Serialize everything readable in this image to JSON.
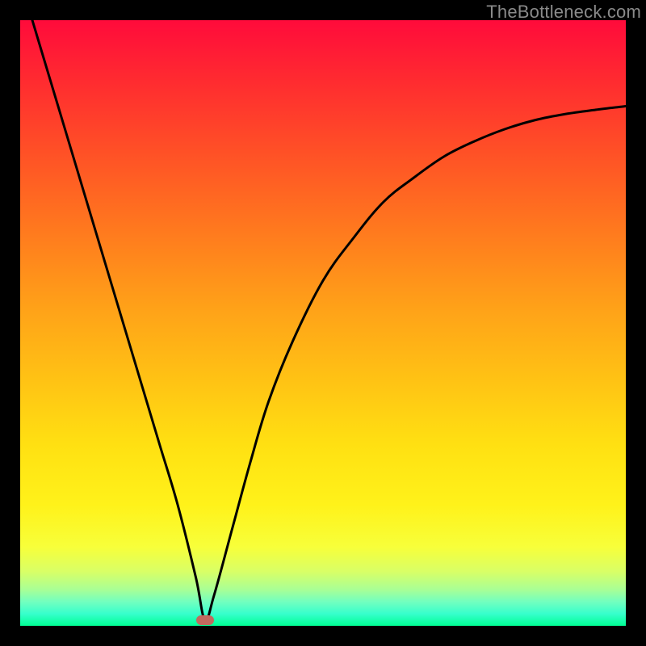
{
  "watermark": "TheBottleneck.com",
  "colors": {
    "frame": "#000000",
    "curve": "#000000",
    "marker": "#c2695f"
  },
  "chart_data": {
    "type": "line",
    "title": "",
    "xlabel": "",
    "ylabel": "",
    "xlim": [
      0,
      100
    ],
    "ylim": [
      0,
      100
    ],
    "grid": false,
    "series": [
      {
        "name": "bottleneck-curve",
        "x": [
          2,
          5,
          8,
          11,
          14,
          17,
          20,
          23,
          26,
          29,
          30.5,
          32,
          35,
          38,
          41,
          45,
          50,
          55,
          60,
          65,
          70,
          75,
          80,
          85,
          90,
          95,
          100
        ],
        "y": [
          100,
          90,
          80,
          70,
          60,
          50,
          40,
          30,
          20,
          8,
          1,
          5,
          16,
          27,
          37,
          47,
          57,
          64,
          70,
          74,
          77.5,
          80,
          82,
          83.5,
          84.5,
          85.2,
          85.8
        ]
      }
    ],
    "annotations": [
      {
        "name": "optimal-marker",
        "x": 30.5,
        "y": 1
      }
    ]
  }
}
